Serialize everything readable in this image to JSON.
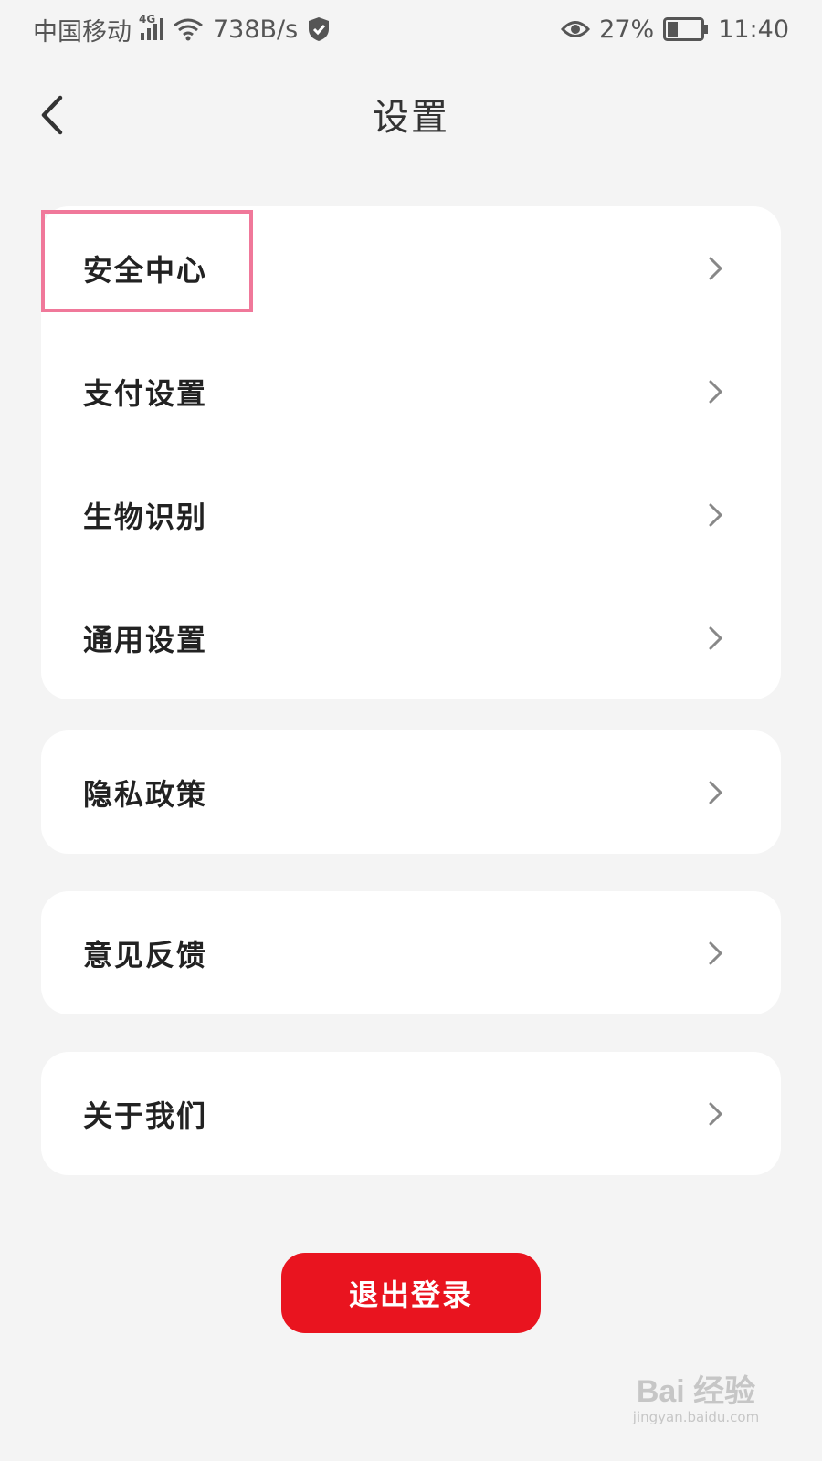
{
  "status_bar": {
    "carrier": "中国移动",
    "network_tag": "4G",
    "speed": "738B/s",
    "battery_percent": "27%",
    "time": "11:40",
    "icons": [
      "signal-icon",
      "wifi-icon",
      "shield-icon",
      "eye-icon",
      "battery-icon"
    ]
  },
  "header": {
    "title": "设置",
    "back_icon": "chevron-left-icon"
  },
  "groups": [
    {
      "items": [
        {
          "label": "安全中心",
          "highlighted": true
        },
        {
          "label": "支付设置"
        },
        {
          "label": "生物识别"
        },
        {
          "label": "通用设置"
        }
      ]
    },
    {
      "items": [
        {
          "label": "隐私政策"
        }
      ]
    },
    {
      "items": [
        {
          "label": "意见反馈"
        }
      ]
    },
    {
      "items": [
        {
          "label": "关于我们"
        }
      ]
    }
  ],
  "logout_label": "退出登录",
  "watermark": {
    "logo": "Bai 经验",
    "url": "jingyan.baidu.com"
  },
  "colors": {
    "accent": "#e9141f",
    "highlight_border": "#f0789a",
    "background": "#f4f4f4"
  }
}
